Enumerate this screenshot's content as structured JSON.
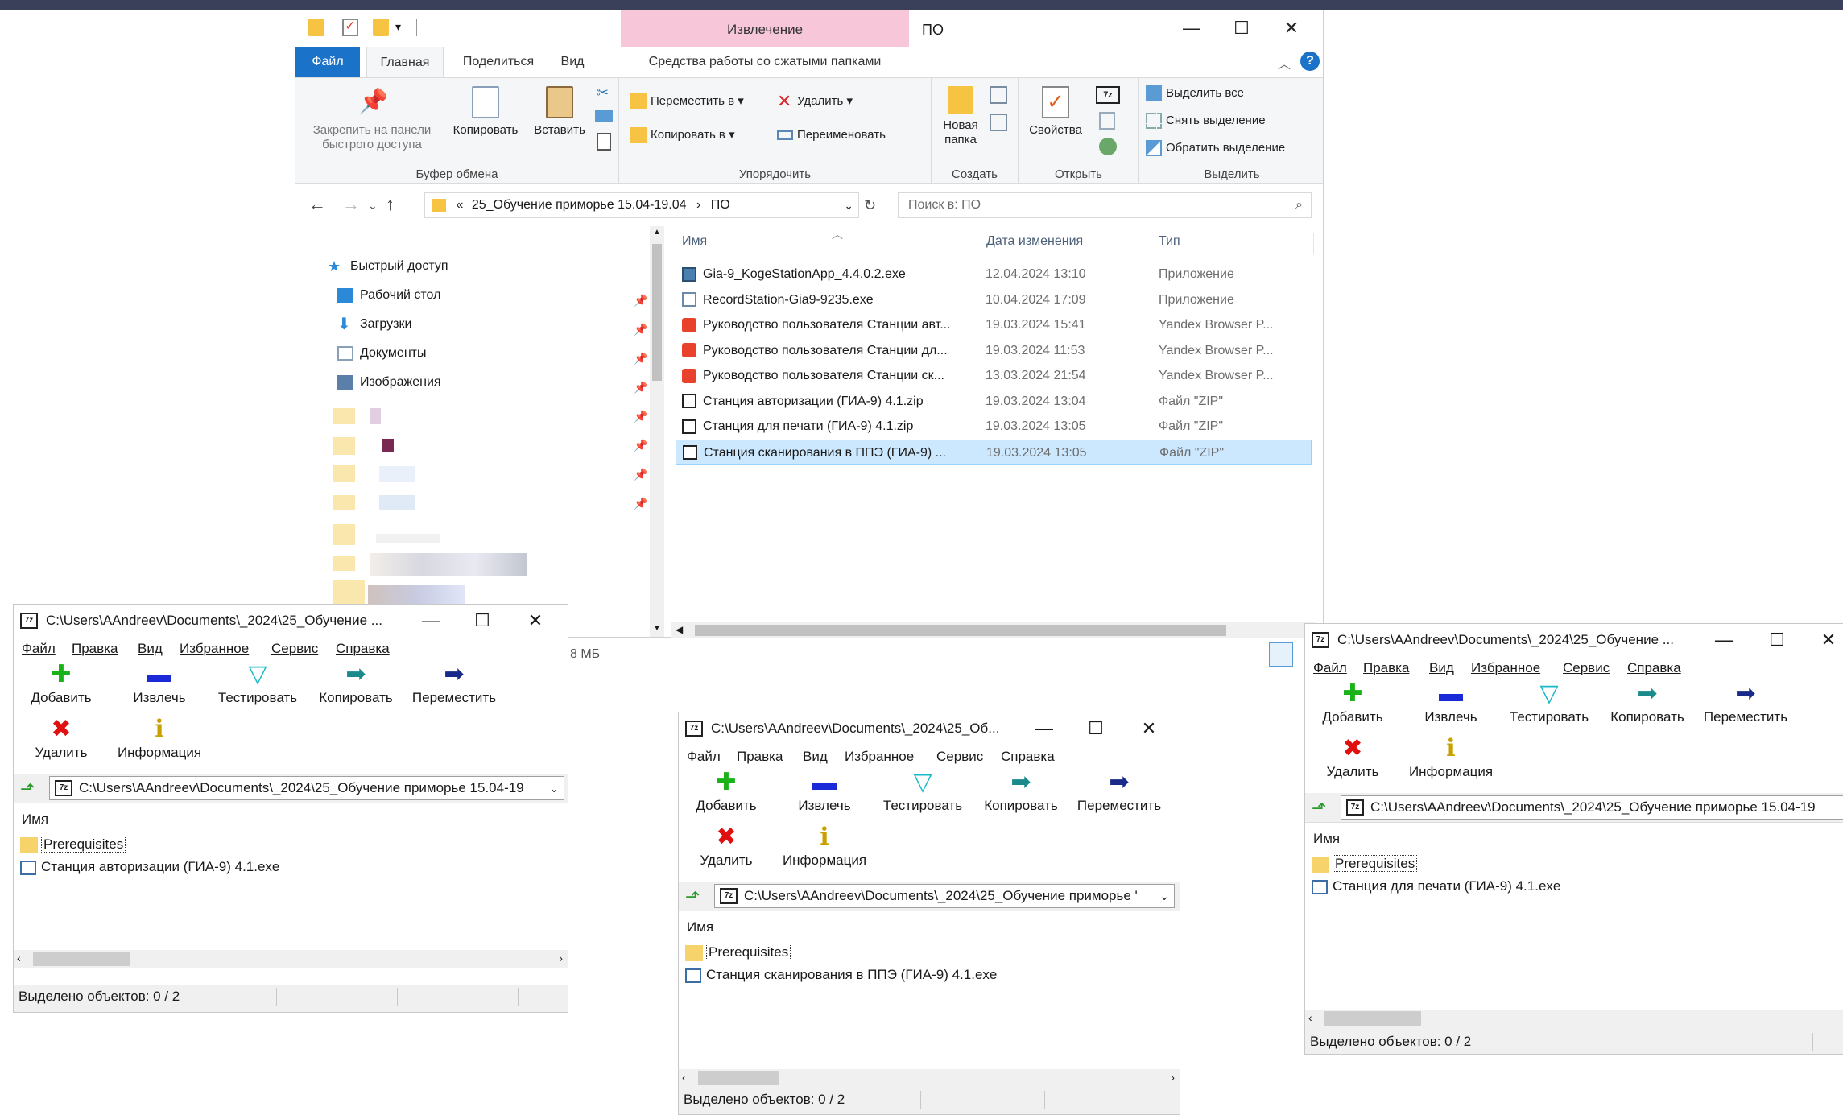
{
  "explorer": {
    "title": "ПО",
    "context_tab": "Извлечение",
    "tabs": [
      "Файл",
      "Главная",
      "Поделиться",
      "Вид",
      "Средства работы со сжатыми папками"
    ],
    "ribbon": {
      "pin": "Закрепить на панели быстрого доступа",
      "copy": "Копировать",
      "paste": "Вставить",
      "clipboard_group": "Буфер обмена",
      "move_to": "Переместить в",
      "copy_to": "Копировать в",
      "delete": "Удалить",
      "rename": "Переименовать",
      "organize_group": "Упорядочить",
      "new_folder": "Новая папка",
      "create_group": "Создать",
      "properties": "Свойства",
      "open_group": "Открыть",
      "select_all": "Выделить все",
      "select_none": "Снять выделение",
      "invert_selection": "Обратить выделение",
      "select_group": "Выделить"
    },
    "address": {
      "prefix": "«",
      "crumb1": "25_Обучение приморье 15.04-19.04",
      "sep": "›",
      "crumb2": "ПО"
    },
    "search_placeholder": "Поиск в: ПО",
    "nav": {
      "quick_access": "Быстрый доступ",
      "desktop": "Рабочий стол",
      "downloads": "Загрузки",
      "documents": "Документы",
      "pictures": "Изображения"
    },
    "columns": {
      "name": "Имя",
      "date": "Дата изменения",
      "type": "Тип"
    },
    "files": [
      {
        "name": "Gia-9_KogeStationApp_4.4.0.2.exe",
        "date": "12.04.2024 13:10",
        "type": "Приложение",
        "icon": "setup-icon"
      },
      {
        "name": "RecordStation-Gia9-9235.exe",
        "date": "10.04.2024 17:09",
        "type": "Приложение",
        "icon": "installer-icon"
      },
      {
        "name": "Руководство пользователя Станции авт...",
        "date": "19.03.2024 15:41",
        "type": "Yandex Browser P...",
        "icon": "pdf-icon"
      },
      {
        "name": "Руководство пользователя Станции дл...",
        "date": "19.03.2024 11:53",
        "type": "Yandex Browser P...",
        "icon": "pdf-icon"
      },
      {
        "name": "Руководство пользователя Станции ск...",
        "date": "13.03.2024 21:54",
        "type": "Yandex Browser P...",
        "icon": "pdf-icon"
      },
      {
        "name": "Станция авторизации (ГИА-9) 4.1.zip",
        "date": "19.03.2024 13:04",
        "type": "Файл \"ZIP\"",
        "icon": "7zip-icon"
      },
      {
        "name": "Станция для печати (ГИА-9) 4.1.zip",
        "date": "19.03.2024 13:05",
        "type": "Файл \"ZIP\"",
        "icon": "7zip-icon"
      },
      {
        "name": "Станция сканирования в ППЭ (ГИА-9) ...",
        "date": "19.03.2024 13:05",
        "type": "Файл \"ZIP\"",
        "icon": "7zip-icon"
      }
    ],
    "status_size": "8 МБ"
  },
  "zip_common": {
    "menu": [
      "Файл",
      "Правка",
      "Вид",
      "Избранное",
      "Сервис",
      "Справка"
    ],
    "tools": [
      "Добавить",
      "Извлечь",
      "Тестировать",
      "Копировать",
      "Переместить",
      "Удалить",
      "Информация"
    ],
    "col_name": "Имя",
    "folder": "Prerequisites",
    "status": "Выделено объектов: 0 / 2"
  },
  "zip1": {
    "title": "C:\\Users\\AAndreev\\Documents\\_2024\\25_Обучение ...",
    "path": "C:\\Users\\AAndreev\\Documents\\_2024\\25_Обучение приморье 15.04-19",
    "exe": "Станция авторизации (ГИА-9) 4.1.exe"
  },
  "zip2": {
    "title": "C:\\Users\\AAndreev\\Documents\\_2024\\25_Об...",
    "path": "C:\\Users\\AAndreev\\Documents\\_2024\\25_Обучение приморье '",
    "exe": "Станция сканирования в ППЭ (ГИА-9) 4.1.exe"
  },
  "zip3": {
    "title": "C:\\Users\\AAndreev\\Documents\\_2024\\25_Обучение ...",
    "path": "C:\\Users\\AAndreev\\Documents\\_2024\\25_Обучение приморье 15.04-19",
    "exe": "Станция для печати (ГИА-9) 4.1.exe"
  },
  "colors": {
    "accent": "#1a73c8",
    "selection": "#cce8ff",
    "context_tab": "#f7c6d9"
  }
}
